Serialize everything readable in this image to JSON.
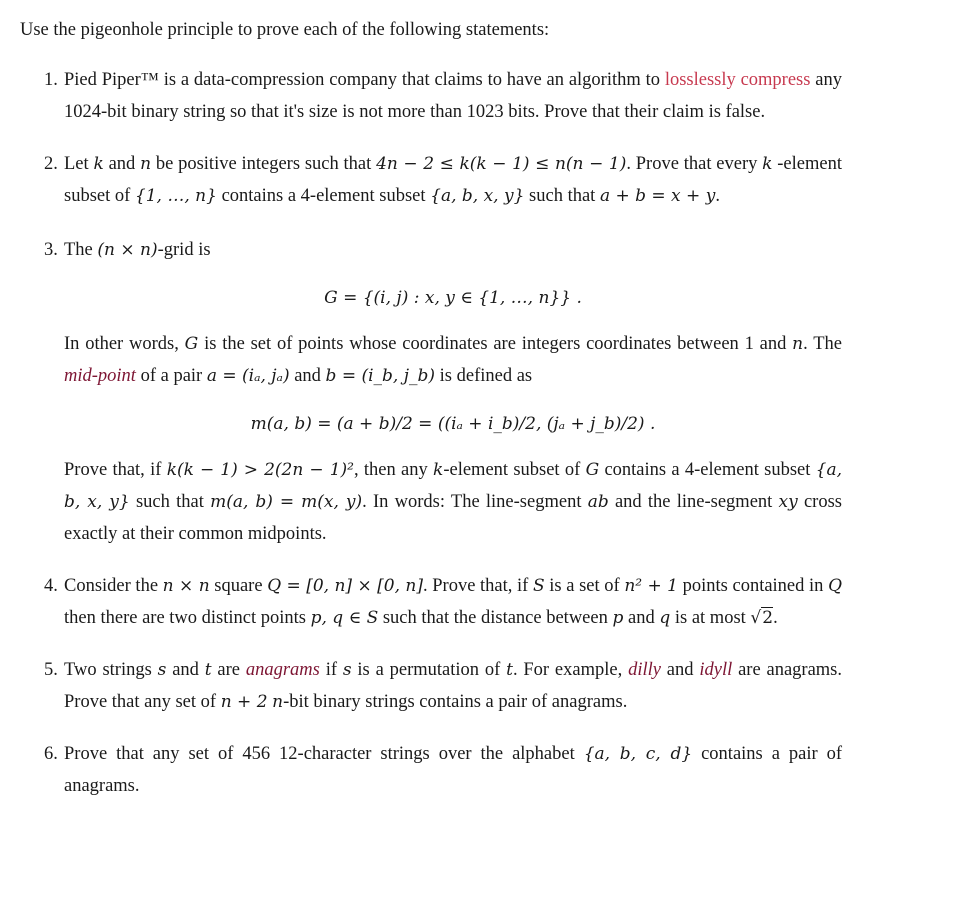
{
  "intro": "Use the pigeonhole principle to prove each of the following statements:",
  "colors": {
    "link": "#c7394f",
    "emphasis": "#7d1533",
    "text": "#1a1a1a"
  },
  "items": [
    {
      "number": "1.",
      "p1": "Pied Piper™ is a data-compression company that claims to have an algorithm to ",
      "link": "losslessly compress",
      "p2": " any 1024-bit binary string so that it's size is not more than 1023 bits. Prove that their claim is false."
    },
    {
      "number": "2.",
      "t1": "Let ",
      "k": "k",
      "t2": " and ",
      "n": "n",
      "t3": " be positive integers such that ",
      "ineq": "4n − 2 ≤ k(k − 1) ≤ n(n − 1)",
      "t4": ". Prove that every ",
      "t5": " -element subset of ",
      "set1": "{1, …, n}",
      "t6": " contains a 4-element subset ",
      "set2": "{a, b, x, y}",
      "t7": " such that ",
      "eq": "a + b = x + y",
      "t8": "."
    },
    {
      "number": "3.",
      "t1": "The ",
      "grid": "(n × n)",
      "t2": "-grid is",
      "display1": "G = {(i, j) : x, y ∈ {1, …, n}}  .",
      "t3": "In other words, ",
      "G": "G",
      "t4": " is the set of points whose coordinates are integers coordinates between 1 and ",
      "n": "n",
      "t5": ". The ",
      "midpoint": "mid-point",
      "t6": " of a pair ",
      "a_def": "a = (iₐ, jₐ)",
      "t7": " and ",
      "b_def": "b = (i_b, j_b)",
      "t8": " is defined as",
      "display2": "m(a, b) = (a + b)/2 = ((iₐ + i_b)/2, (jₐ + j_b)/2)  .",
      "t9": "Prove that, if ",
      "cond": "k(k − 1) > 2(2n − 1)²",
      "t10": ", then any ",
      "k": "k",
      "t11": "-element subset of ",
      "t12": " contains a 4-element subset ",
      "set": "{a, b, x, y}",
      "t13": " such that ",
      "eq": "m(a, b) = m(x, y)",
      "t14": ". In words: The line-segment ",
      "ab": "ab",
      "t15": " and the line-segment ",
      "xy": "xy",
      "t16": " cross exactly at their common midpoints."
    },
    {
      "number": "4.",
      "t1": "Consider the ",
      "nxn": "n × n",
      "t2": " square ",
      "Q": "Q = [0, n] × [0, n]",
      "t3": ". Prove that, if ",
      "S": "S",
      "t4": " is a set of ",
      "count": "n² + 1",
      "t5": " points contained in ",
      "Qs": "Q",
      "t6": " then there are two distinct points ",
      "pq": "p, q ∈ S",
      "t7": " such that the distance between ",
      "p": "p",
      "t8": " and ",
      "q": "q",
      "t9": " is at most ",
      "sqrt": "2",
      "t10": "."
    },
    {
      "number": "5.",
      "t1": "Two strings ",
      "s": "s",
      "t2": " and ",
      "t": "t",
      "t3": " are ",
      "anagrams": "anagrams",
      "t4": " if ",
      "t5": " is a permutation of ",
      "t6": ". For example, ",
      "ex1": "dilly",
      "t7": " and ",
      "ex2": "idyll",
      "t8": " are anagrams. Prove that any set of ",
      "np2": "n + 2",
      "t9": " ",
      "nbit": "n",
      "t10": "-bit binary strings contains a pair of anagrams."
    },
    {
      "number": "6.",
      "t1": "Prove that any set of 456 12-character strings over the alphabet ",
      "alphabet": "{a, b, c, d}",
      "t2": " contains a pair of anagrams."
    }
  ]
}
